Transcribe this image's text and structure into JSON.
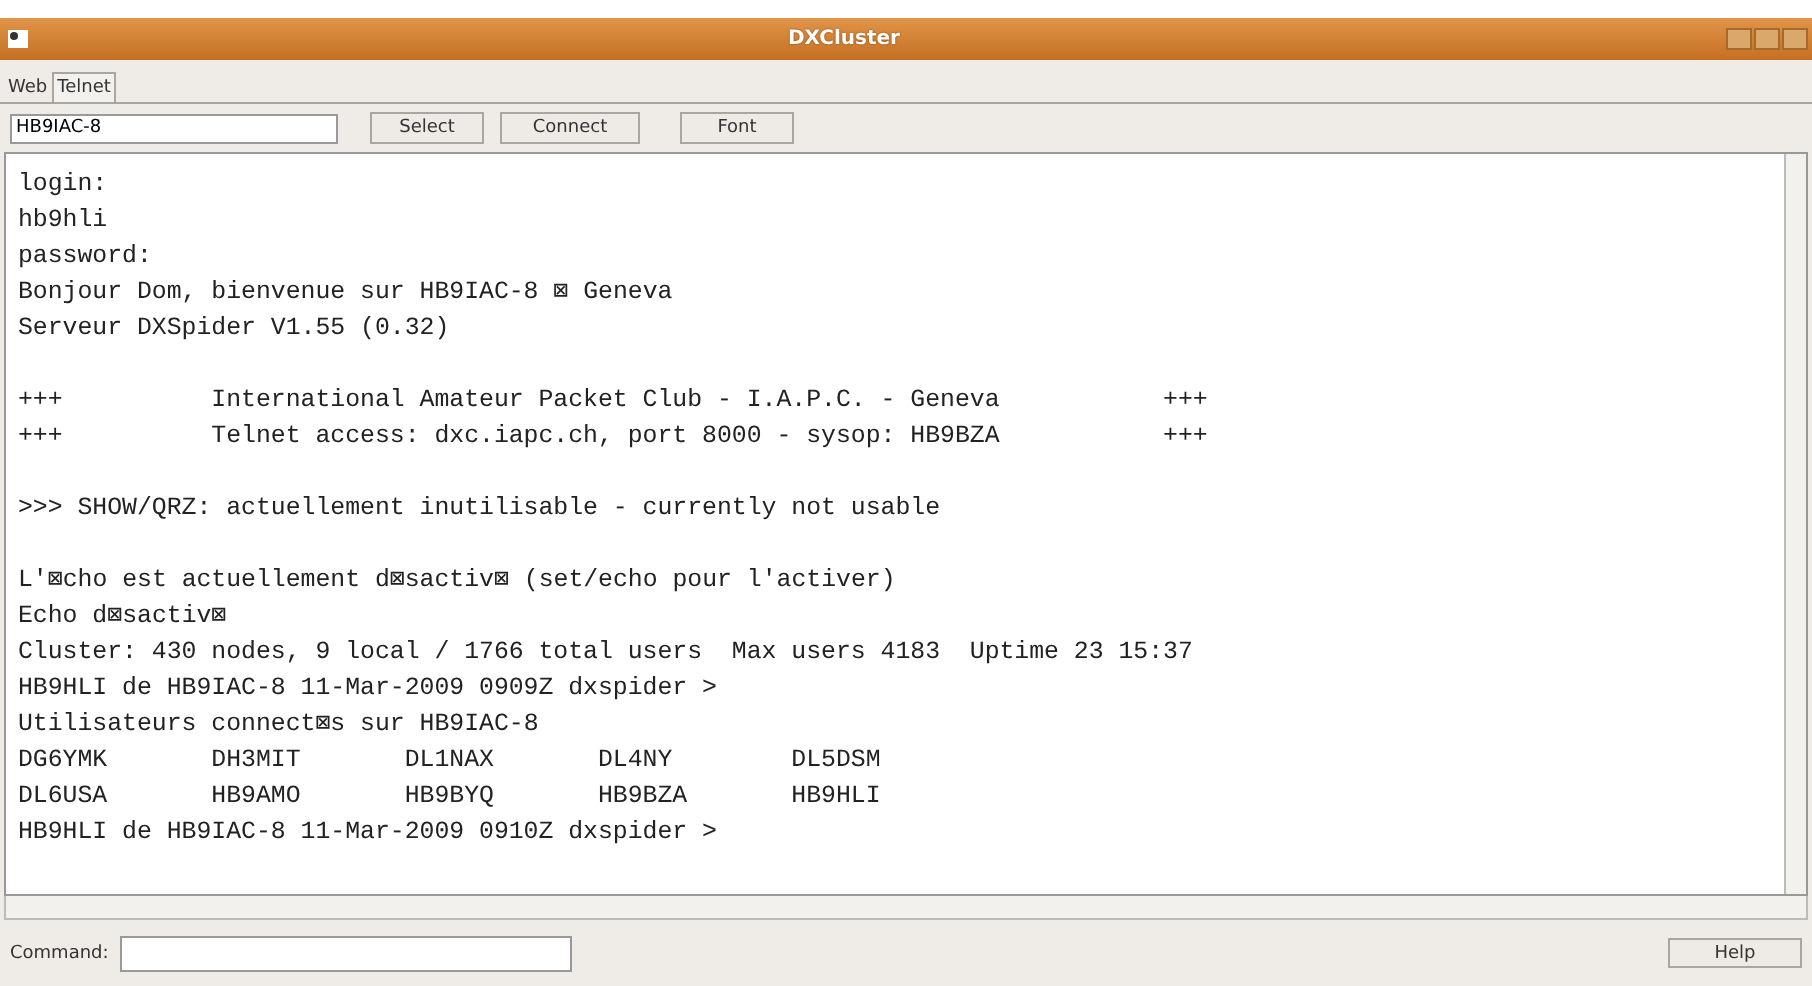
{
  "window": {
    "title": "DXCluster"
  },
  "tabs": [
    {
      "label": "Web",
      "selected": false
    },
    {
      "label": "Telnet",
      "selected": true
    }
  ],
  "toolbar": {
    "host": "HB9IAC-8",
    "buttons": [
      "Select",
      "Connect",
      "Font"
    ]
  },
  "terminal": {
    "blocks": [
      {
        "lines": [
          "login:",
          "hb9hli",
          "password:",
          "Bonjour Dom, bienvenue sur HB9IAC-8 ⊠ Geneva",
          "Serveur DXSpider V1.55 (0.32)"
        ]
      },
      {
        "lines": [
          "+++          International Amateur Packet Club - I.A.P.C. - Geneva           +++",
          "+++          Telnet access: dxc.iapc.ch, port 8000 - sysop: HB9BZA           +++"
        ]
      },
      {
        "lines": [
          ">>> SHOW/QRZ: actuellement inutilisable - currently not usable"
        ]
      },
      {
        "lines": [
          "L'⊠cho est actuellement d⊠sactiv⊠ (set/echo pour l'activer)",
          "Echo d⊠sactiv⊠",
          "Cluster: 430 nodes, 9 local / 1766 total users  Max users 4183  Uptime 23 15:37",
          "HB9HLI de HB9IAC-8 11-Mar-2009 0909Z dxspider >",
          "Utilisateurs connect⊠s sur HB9IAC-8",
          "DG6YMK       DH3MIT       DL1NAX       DL4NY        DL5DSM",
          "DL6USA       HB9AMO       HB9BYQ       HB9BZA       HB9HLI",
          "HB9HLI de HB9IAC-8 11-Mar-2009 0910Z dxspider >"
        ]
      }
    ]
  },
  "command": {
    "label": "Command:",
    "help": "Help"
  }
}
